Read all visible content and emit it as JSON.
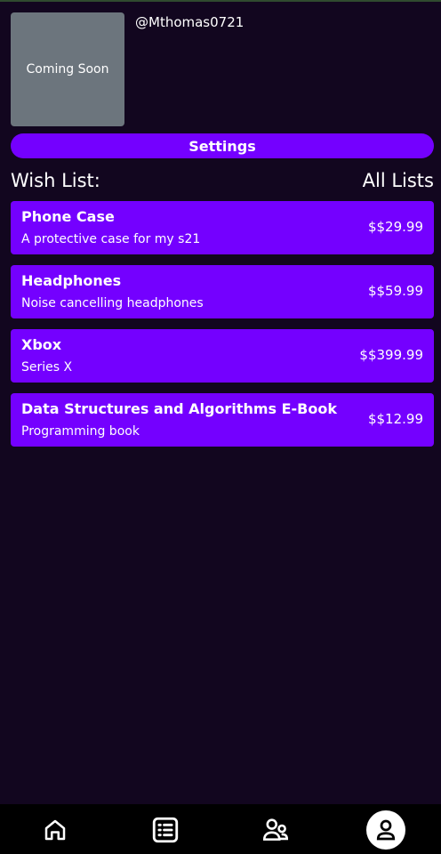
{
  "profile": {
    "avatar_placeholder": "Coming Soon",
    "username": "@Mthomas0721"
  },
  "settings_label": "Settings",
  "wishlist": {
    "title": "Wish List:",
    "all_lists_label": "All Lists",
    "items": [
      {
        "name": "Phone Case",
        "description": "A protective case for my s21",
        "price": "$$29.99"
      },
      {
        "name": "Headphones",
        "description": "Noise cancelling headphones",
        "price": "$$59.99"
      },
      {
        "name": "Xbox",
        "description": "Series X",
        "price": "$$399.99"
      },
      {
        "name": "Data Structures and Algorithms E-Book",
        "description": "Programming book",
        "price": "$$12.99"
      }
    ]
  },
  "navbar": {
    "items": [
      {
        "icon": "home-icon",
        "active": false
      },
      {
        "icon": "list-icon",
        "active": false
      },
      {
        "icon": "friends-icon",
        "active": false
      },
      {
        "icon": "profile-icon",
        "active": true
      }
    ]
  },
  "colors": {
    "background": "#12061f",
    "accent": "#7400ff",
    "avatar_placeholder": "#6c757d",
    "navbar": "#000000"
  }
}
